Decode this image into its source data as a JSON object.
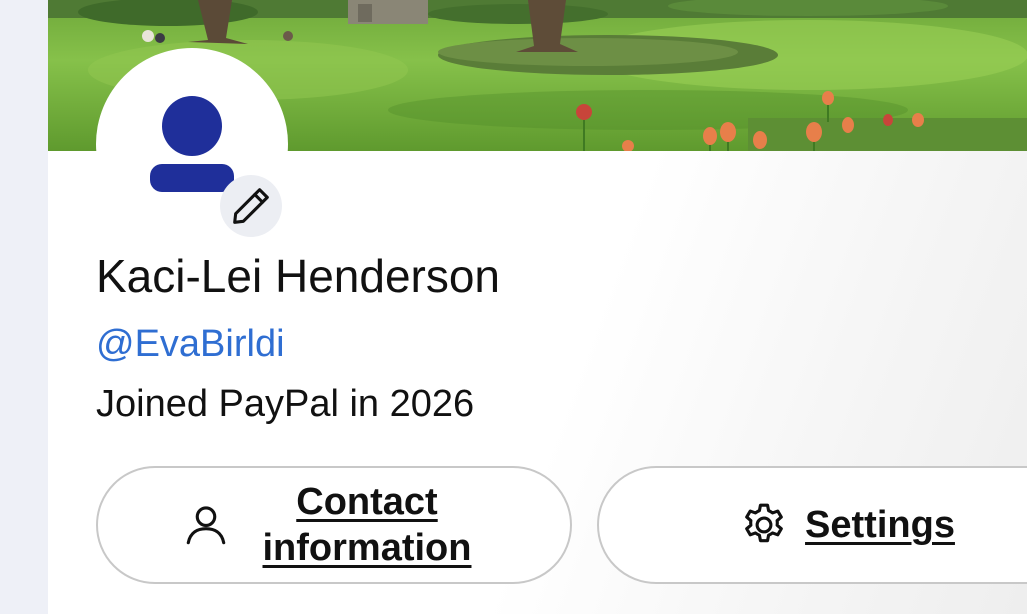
{
  "profile": {
    "name": "Kaci-Lei Henderson",
    "handle": "@EvaBirldi",
    "joined": "Joined PayPal in 2026"
  },
  "actions": {
    "contact_label": "Contact information",
    "settings_label": "Settings"
  },
  "icons": {
    "avatar": "person-silhouette-icon",
    "edit": "pencil-icon",
    "contact": "person-outline-icon",
    "settings": "gear-icon"
  },
  "colors": {
    "handle_link": "#2f6ed2",
    "avatar_figure": "#1f2f9a",
    "rail_background": "#eef0f7",
    "pill_border": "#c8c8c8"
  }
}
